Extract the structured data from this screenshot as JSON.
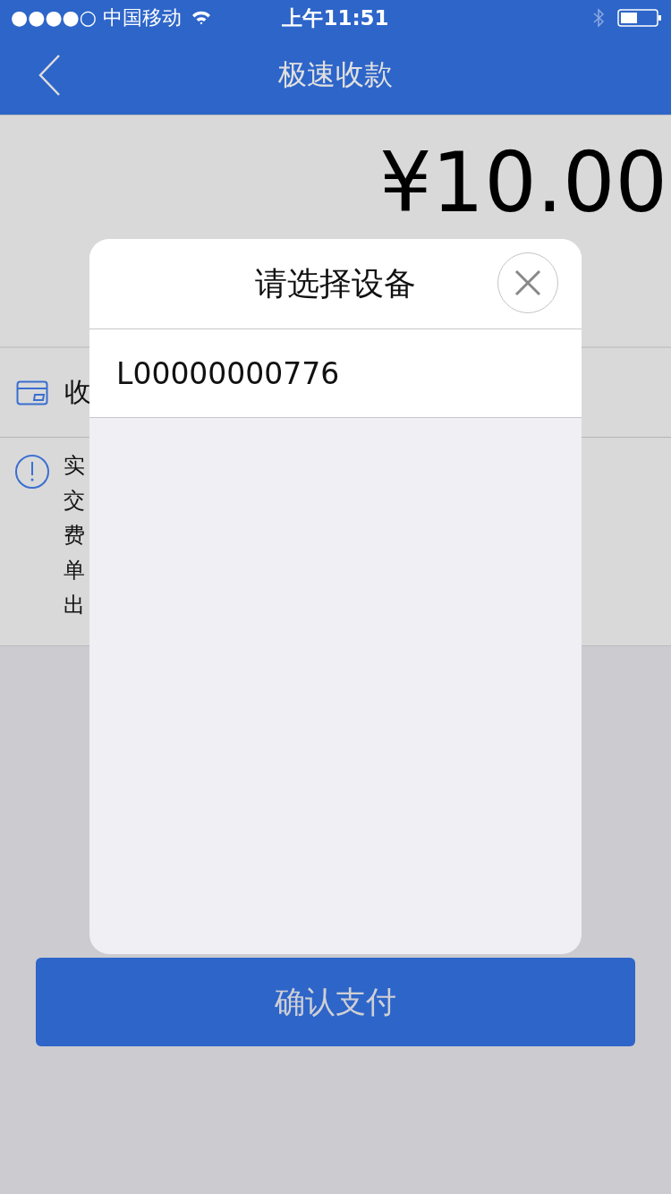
{
  "status_bar": {
    "carrier": "●●●●○ 中国移动",
    "time": "上午11:51"
  },
  "nav": {
    "title": "极速收款"
  },
  "amount": "¥10.00",
  "payment_label": "收",
  "info_lines": [
    "实",
    "交",
    "费",
    "单",
    "出"
  ],
  "confirm_button": "确认支付",
  "dialog": {
    "title": "请选择设备",
    "devices": [
      "L00000000776"
    ]
  }
}
